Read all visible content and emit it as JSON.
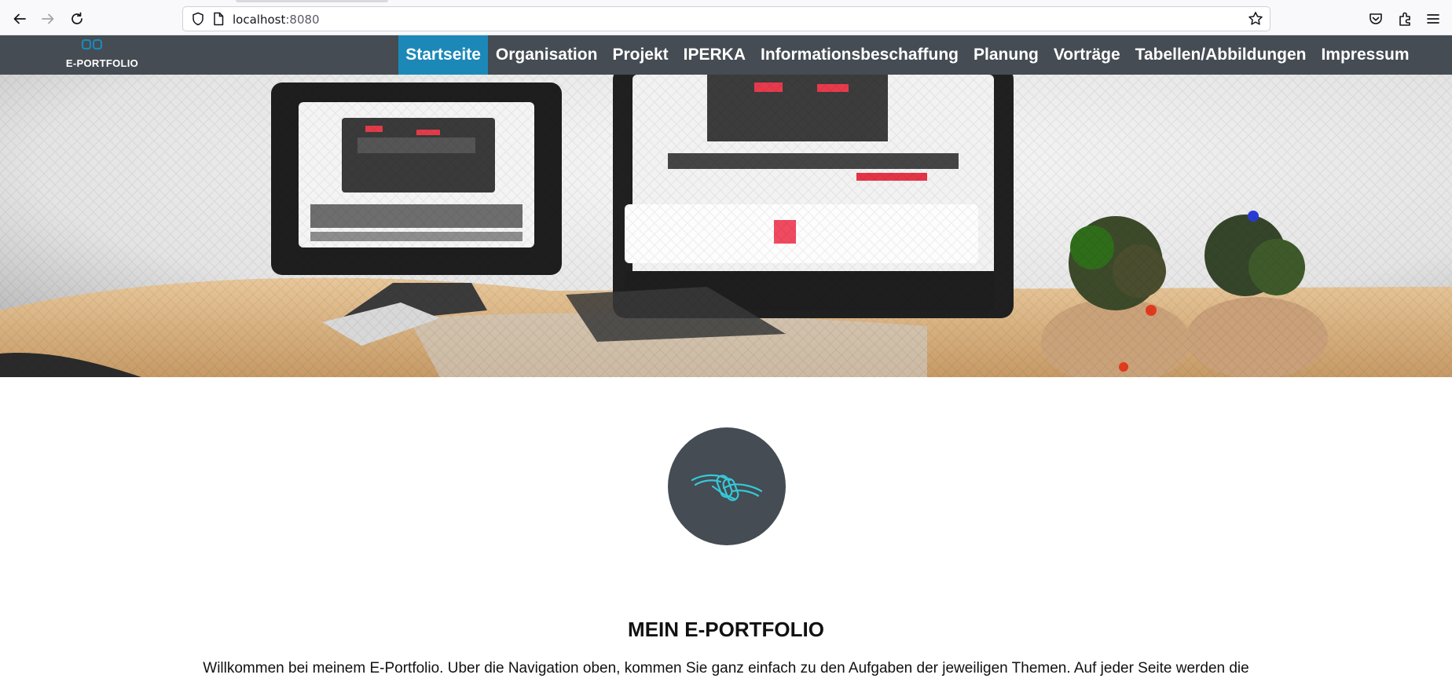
{
  "browser": {
    "url_host": "localhost",
    "url_port": ":8080",
    "icons": [
      "back-arrow-icon",
      "forward-arrow-icon",
      "reload-icon",
      "shield-icon",
      "page-icon",
      "bookmark-star-icon",
      "pocket-icon",
      "extensions-icon",
      "menu-icon"
    ]
  },
  "header": {
    "logo_text": "E-PORTFOLIO",
    "nav": [
      {
        "label": "Startseite",
        "active": true
      },
      {
        "label": "Organisation",
        "active": false
      },
      {
        "label": "Projekt",
        "active": false
      },
      {
        "label": "IPERKA",
        "active": false
      },
      {
        "label": "Informationsbeschaffung",
        "active": false
      },
      {
        "label": "Planung",
        "active": false
      },
      {
        "label": "Vorträge",
        "active": false
      },
      {
        "label": "Tabellen/Abbildungen",
        "active": false
      },
      {
        "label": "Impressum",
        "active": false
      }
    ]
  },
  "main": {
    "title": "MEIN E-PORTFOLIO",
    "intro": "Willkommen bei meinem E-Portfolio. Uber die Navigation oben, kommen Sie ganz einfach zu den Aufgaben der jeweiligen Themen. Auf jeder Seite werden die"
  },
  "colors": {
    "header_bg": "#454c53",
    "nav_active_bg": "#1c88b8",
    "emblem_bg": "#454c53",
    "emblem_stroke": "#35c8d8"
  }
}
